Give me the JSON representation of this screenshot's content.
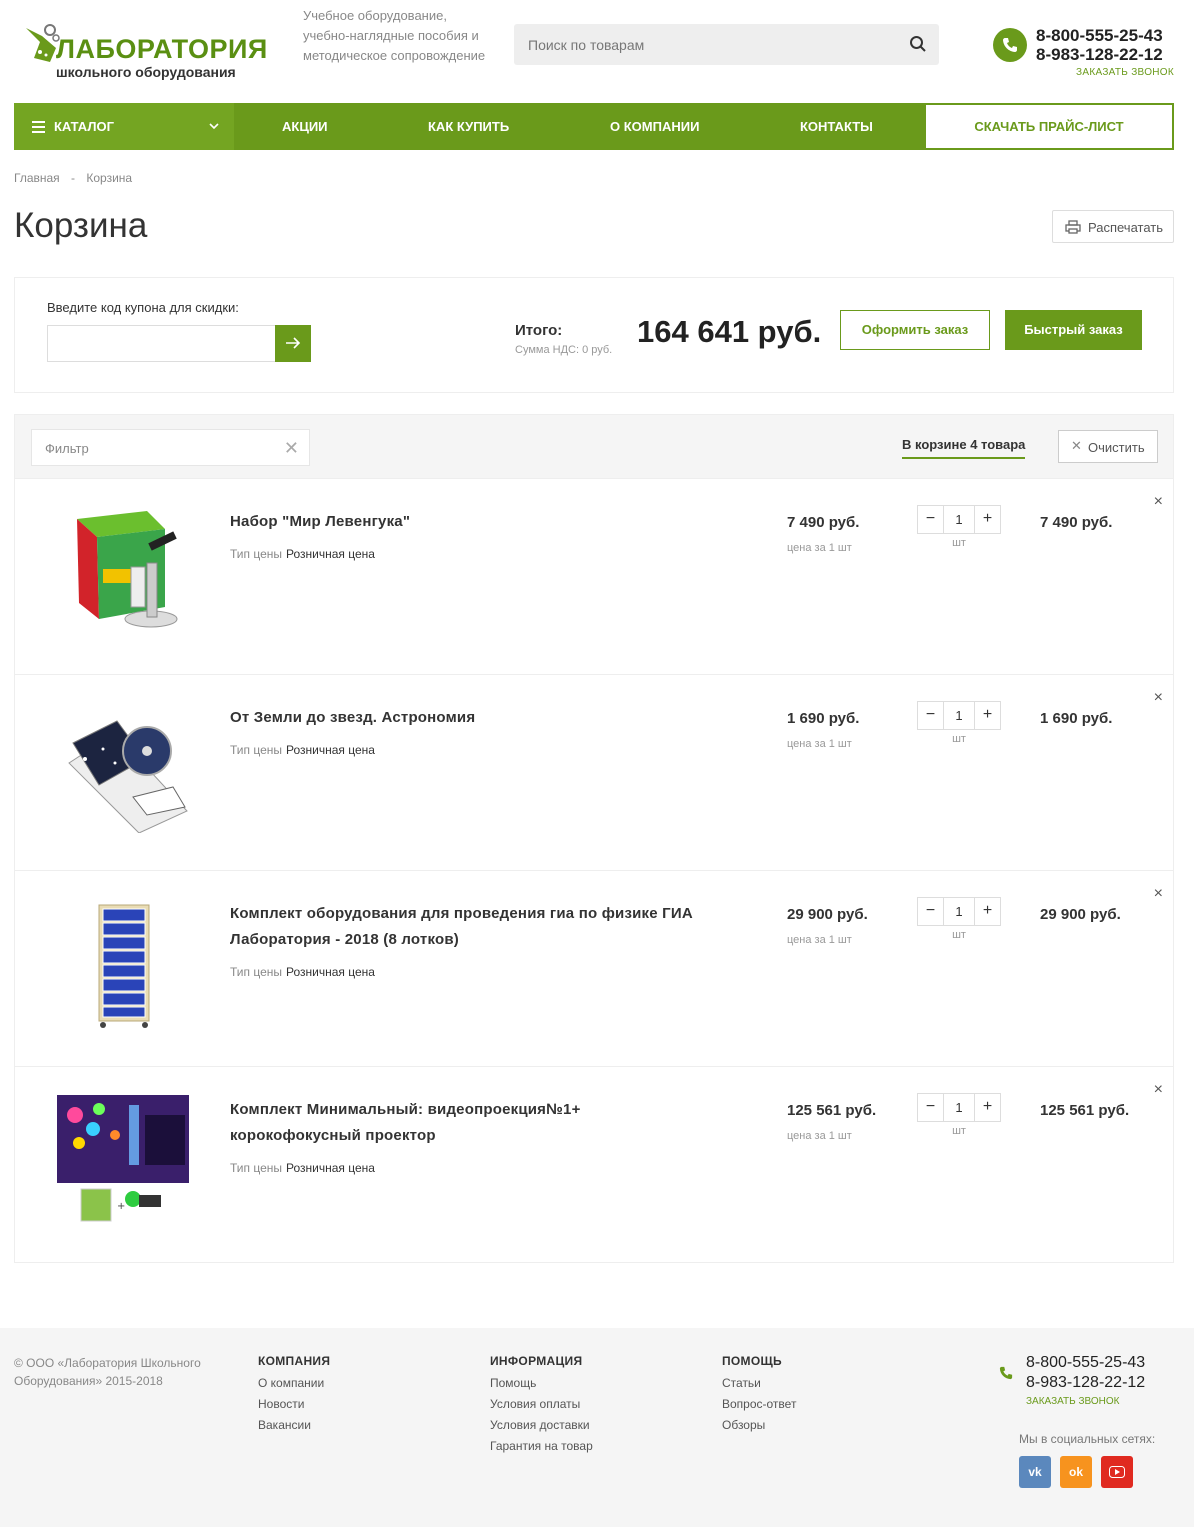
{
  "header": {
    "logo_title": "ЛАБОРАТОРИЯ",
    "logo_sub": "школьного оборудования",
    "tagline": "Учебное оборудование, учебно-наглядные пособия и методическое сопровождение",
    "search_placeholder": "Поиск по товарам",
    "phone1": "8-800-555-25-43",
    "phone2": "8-983-128-22-12",
    "callback": "ЗАКАЗАТЬ ЗВОНОК"
  },
  "nav": {
    "catalog": "КАТАЛОГ",
    "items": [
      "АКЦИИ",
      "КАК КУПИТЬ",
      "О КОМПАНИИ",
      "КОНТАКТЫ"
    ],
    "price_list": "СКАЧАТЬ ПРАЙС-ЛИСТ"
  },
  "breadcrumb": {
    "home": "Главная",
    "sep": "-",
    "current": "Корзина"
  },
  "page": {
    "title": "Корзина",
    "print": "Распечатать"
  },
  "summary": {
    "coupon_label": "Введите код купона для скидки:",
    "total_label": "Итого:",
    "vat": "Сумма НДС: 0 руб.",
    "total": "164 641 руб.",
    "order_btn": "Оформить заказ",
    "quick_btn": "Быстрый заказ"
  },
  "cart": {
    "filter_placeholder": "Фильтр",
    "count_label": "В корзине 4 товара",
    "clear": "Очистить",
    "price_type_label": "Тип цены",
    "price_type_value": "Розничная цена",
    "per_unit": "цена за 1 шт",
    "unit": "шт",
    "items": [
      {
        "name": "Набор \"Мир Левенгука\"",
        "price": "7 490 руб.",
        "qty": "1",
        "sum": "7 490 руб."
      },
      {
        "name": "От Земли до звезд. Астрономия",
        "price": "1 690 руб.",
        "qty": "1",
        "sum": "1 690 руб."
      },
      {
        "name": "Комплект оборудования для проведения гиа по физике ГИА Лаборатория - 2018 (8 лотков)",
        "price": "29 900 руб.",
        "qty": "1",
        "sum": "29 900 руб."
      },
      {
        "name": "Комплект Минимальный: видеопроекция№1+ корокофокусный проектор",
        "price": "125 561 руб.",
        "qty": "1",
        "sum": "125 561 руб."
      }
    ]
  },
  "footer": {
    "copyright": "© ООО «Лаборатория Школьного Оборудования» 2015-2018",
    "company": {
      "title": "КОМПАНИЯ",
      "links": [
        "О компании",
        "Новости",
        "Вакансии"
      ]
    },
    "info": {
      "title": "ИНФОРМАЦИЯ",
      "links": [
        "Помощь",
        "Условия оплаты",
        "Условия доставки",
        "Гарантия на товар"
      ]
    },
    "help": {
      "title": "ПОМОЩЬ",
      "links": [
        "Статьи",
        "Вопрос-ответ",
        "Обзоры"
      ]
    },
    "phone1": "8-800-555-25-43",
    "phone2": "8-983-128-22-12",
    "callback": "ЗАКАЗАТЬ ЗВОНОК",
    "social_label": "Мы в социальных сетях:",
    "social": [
      "vk-icon",
      "ok-icon",
      "youtube-icon"
    ]
  },
  "colors": {
    "accent": "#6a9a1b",
    "vk": "#5b88bd",
    "ok": "#f7931e",
    "youtube": "#e02a20"
  }
}
